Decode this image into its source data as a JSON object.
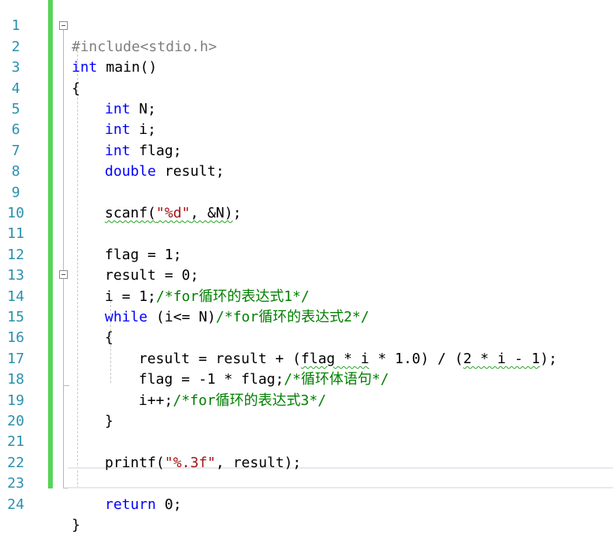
{
  "editor": {
    "line_numbers": [
      "1",
      "2",
      "3",
      "4",
      "5",
      "6",
      "7",
      "8",
      "9",
      "10",
      "11",
      "12",
      "13",
      "14",
      "15",
      "16",
      "17",
      "18",
      "19",
      "20",
      "21",
      "22",
      "23",
      "24"
    ],
    "lines": {
      "l1": {
        "text": "#include<stdio.h>"
      },
      "l2": {
        "kw": "int",
        "rest": " main()"
      },
      "l3": {
        "text": "{"
      },
      "l4": {
        "kw": "int",
        "rest": " N;"
      },
      "l5": {
        "kw": "int",
        "rest": " i;"
      },
      "l6": {
        "kw": "int",
        "rest": " flag;"
      },
      "l7": {
        "kw": "double",
        "rest": " result;"
      },
      "l9": {
        "a": "scanf(",
        "str": "\"%d\"",
        "b": ", &N)",
        "c": ";"
      },
      "l11": {
        "text": "flag = 1;"
      },
      "l12": {
        "text": "result = 0;"
      },
      "l13": {
        "code": "i = 1;",
        "comment": "/*for循环的表达式1*/"
      },
      "l14": {
        "kw": "while",
        "code": " (i<= N)",
        "comment": "/*for循环的表达式2*/"
      },
      "l15": {
        "text": "{"
      },
      "l16": {
        "a": "result = result + (",
        "b": "flag * i",
        "c": " * 1.0) / (",
        "d": "2 * i - 1",
        "e": ");"
      },
      "l17": {
        "code": "flag = -1 * flag;",
        "comment": "/*循环体语句*/"
      },
      "l18": {
        "code": "i++;",
        "comment": "/*for循环的表达式3*/"
      },
      "l19": {
        "text": "}"
      },
      "l21": {
        "a": "printf(",
        "str": "\"%.3f\"",
        "b": ", result);"
      },
      "l23": {
        "kw": "return",
        "rest": " 0;"
      },
      "l24": {
        "text": "}"
      }
    }
  },
  "colors": {
    "keyword": "#0000ff",
    "string": "#a31515",
    "comment": "#008000",
    "line_number": "#2b91af",
    "change_bar": "#57d35a"
  }
}
